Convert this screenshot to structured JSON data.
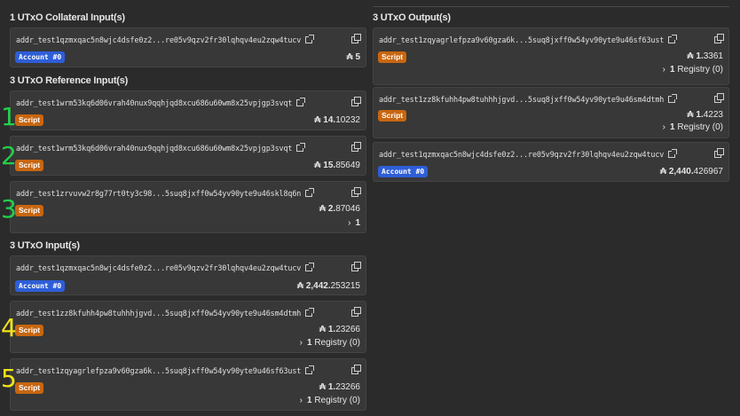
{
  "sections": {
    "collateral_title": "1 UTxO Collateral Input(s)",
    "reference_title": "3 UTxO Reference Input(s)",
    "inputs_title": "3 UTxO Input(s)",
    "outputs_title": "3 UTxO Output(s)"
  },
  "collateral": [
    {
      "address": "addr_test1qzmxqac5n8wjc4dsfe0z2...re05v9qzv2fr30lqhqv4eu2zqw4tucv",
      "badge": "Account #0",
      "amount_int": "₳ 5",
      "amount_dec": ""
    }
  ],
  "reference": [
    {
      "address": "addr_test1wrm53kq6d06vrah40nux9qqhjqd8xcu686u60wm8x25vpjgp3svqt",
      "badge": "Script",
      "amount_int": "₳ 14.",
      "amount_dec": "10232",
      "registry": ""
    },
    {
      "address": "addr_test1wrm53kq6d06vrah40nux9qqhjqd8xcu686u60wm8x25vpjgp3svqt",
      "badge": "Script",
      "amount_int": "₳ 15.",
      "amount_dec": "85649",
      "registry": ""
    },
    {
      "address": "addr_test1zrvuvw2r8g77rt0ty3c98...5suq8jxff0w54yv90yte9u46skl8q6n",
      "badge": "Script",
      "amount_int": "₳ 2.",
      "amount_dec": "87046",
      "registry_num": "1",
      "registry_text": ""
    }
  ],
  "inputs": [
    {
      "address": "addr_test1qzmxqac5n8wjc4dsfe0z2...re05v9qzv2fr30lqhqv4eu2zqw4tucv",
      "badge": "Account #0",
      "amount_int": "₳ 2,442.",
      "amount_dec": "253215"
    },
    {
      "address": "addr_test1zz8kfuhh4pw8tuhhhjgvd...5suq8jxff0w54yv90yte9u46sm4dtmh",
      "badge": "Script",
      "amount_int": "₳ 1.",
      "amount_dec": "23266",
      "registry_num": "1",
      "registry_text": " Registry (0)"
    },
    {
      "address": "addr_test1zqyagrlefpza9v60gza6k...5suq8jxff0w54yv90yte9u46sf63ust",
      "badge": "Script",
      "amount_int": "₳ 1.",
      "amount_dec": "23266",
      "registry_num": "1",
      "registry_text": " Registry (0)"
    }
  ],
  "outputs": [
    {
      "address": "addr_test1zqyagrlefpza9v60gza6k...5suq8jxff0w54yv90yte9u46sf63ust",
      "badge": "Script",
      "amount_int": "₳ 1.",
      "amount_dec": "3361",
      "registry_num": "1",
      "registry_text": " Registry (0)"
    },
    {
      "address": "addr_test1zz8kfuhh4pw8tuhhhjgvd...5suq8jxff0w54yv90yte9u46sm4dtmh",
      "badge": "Script",
      "amount_int": "₳ 1.",
      "amount_dec": "4223",
      "registry_num": "1",
      "registry_text": " Registry (0)"
    },
    {
      "address": "addr_test1qzmxqac5n8wjc4dsfe0z2...re05v9qzv2fr30lqhqv4eu2zqw4tucv",
      "badge": "Account #0",
      "amount_int": "₳ 2,440.",
      "amount_dec": "426967"
    }
  ],
  "annotations": {
    "green": [
      "1",
      "2",
      "3"
    ],
    "yellow": [
      "4",
      "5"
    ],
    "green_color": "#22d04a",
    "yellow_color": "#f2e21a"
  },
  "icons": {
    "external": "external-link-icon",
    "copy": "copy-icon",
    "chevron": "chevron-right-icon"
  }
}
